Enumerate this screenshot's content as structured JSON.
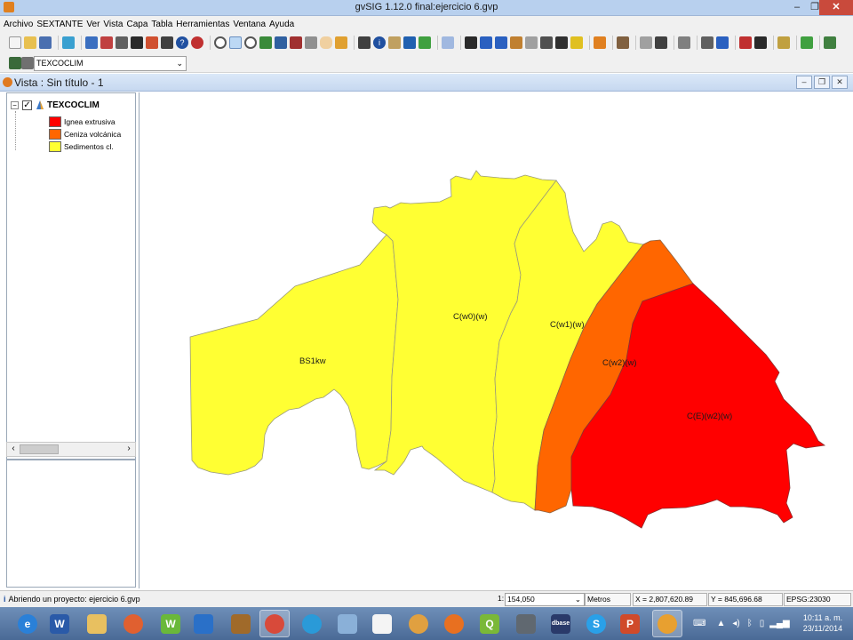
{
  "window": {
    "title": "gvSIG 1.12.0 final:ejercicio 6.gvp",
    "minimize": "–",
    "maximize": "❐",
    "close": "✕"
  },
  "menu": [
    {
      "label": "Archivo"
    },
    {
      "label": "SEXTANTE"
    },
    {
      "label": "Ver"
    },
    {
      "label": "Vista"
    },
    {
      "label": "Capa"
    },
    {
      "label": "Tabla"
    },
    {
      "label": "Herramientas"
    },
    {
      "label": "Ventana"
    },
    {
      "label": "Ayuda"
    }
  ],
  "toolbar": {
    "active_layer": "TEXCOCLIM"
  },
  "view": {
    "title": "Vista : Sin título - 1"
  },
  "toc": {
    "layer": {
      "name": "TEXCOCLIM",
      "checked": "✓"
    },
    "legend": [
      {
        "label": "Ignea extrusiva",
        "color": "#ff0000"
      },
      {
        "label": "Ceniza volcánica",
        "color": "#ff6600"
      },
      {
        "label": "Sedimentos cl.",
        "color": "#ffff33"
      }
    ]
  },
  "map": {
    "fill_colors": {
      "sediment": "#ffff33",
      "ash": "#ff6600",
      "igneous": "#ff0000"
    },
    "labels": [
      {
        "text": "BS1kw"
      },
      {
        "text": "C(w0)(w)"
      },
      {
        "text": "C(w1)(w)"
      },
      {
        "text": "C(w2)(w)"
      },
      {
        "text": "C(E)(w2)(w)"
      }
    ]
  },
  "status": {
    "message": "Abriendo un proyecto: ejercicio 6.gvp",
    "scale_prefix": "1:",
    "scale": "154,050",
    "units": "Metros",
    "x": "X = 2,807,620.89",
    "y": "Y = 845,696.68",
    "epsg": "EPSG:23030"
  },
  "taskbar": {
    "time": "10:11 a. m.",
    "date": "23/11/2014"
  }
}
